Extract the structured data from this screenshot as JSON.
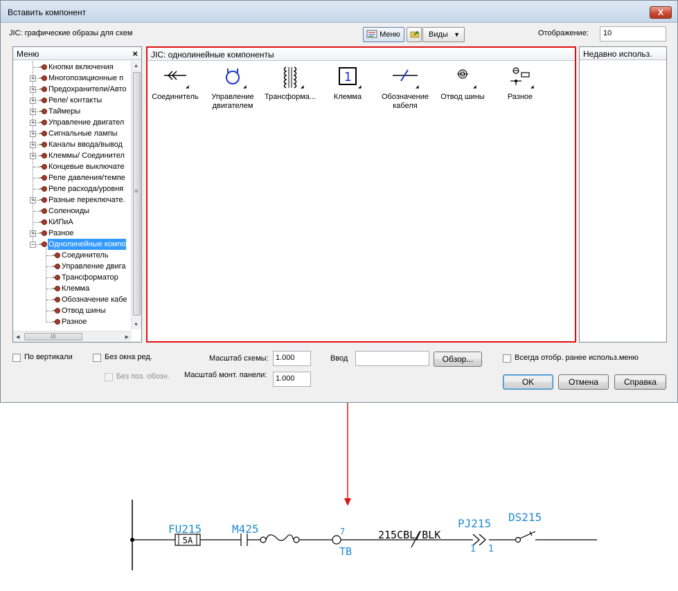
{
  "dialog": {
    "title": "Вставить компонент",
    "close_label": "X"
  },
  "toolbar": {
    "library_label": "JIC: графические образы для схем",
    "menu_button": "Меню",
    "views_button": "Виды",
    "display_label": "Отображение:",
    "display_value": "10"
  },
  "menu_panel": {
    "title": "Меню",
    "close_label": "×",
    "scroll_h_grip": "III",
    "items": [
      {
        "label": "Кнопки включения",
        "level": 0,
        "expander": "none"
      },
      {
        "label": "Многопозиционные п",
        "level": 0,
        "expander": "plus"
      },
      {
        "label": "Предохранители/Авто",
        "level": 0,
        "expander": "plus"
      },
      {
        "label": "Реле/ контакты",
        "level": 0,
        "expander": "plus"
      },
      {
        "label": "Таймеры",
        "level": 0,
        "expander": "plus"
      },
      {
        "label": "Управление двигател",
        "level": 0,
        "expander": "plus"
      },
      {
        "label": "Сигнальные лампы",
        "level": 0,
        "expander": "plus"
      },
      {
        "label": "Каналы ввода/вывод",
        "level": 0,
        "expander": "plus"
      },
      {
        "label": "Клеммы/ Соединител",
        "level": 0,
        "expander": "plus"
      },
      {
        "label": "Концевые выключате",
        "level": 0,
        "expander": "none"
      },
      {
        "label": "Реле давления/темпе",
        "level": 0,
        "expander": "none"
      },
      {
        "label": "Реле расхода/уровня",
        "level": 0,
        "expander": "none"
      },
      {
        "label": "Разные переключате.",
        "level": 0,
        "expander": "plus"
      },
      {
        "label": "Соленоиды",
        "level": 0,
        "expander": "none"
      },
      {
        "label": "КИПиА",
        "level": 0,
        "expander": "none"
      },
      {
        "label": "Разное",
        "level": 0,
        "expander": "plus"
      },
      {
        "label": "Однолинейные компо",
        "level": 0,
        "expander": "minus",
        "selected": true
      },
      {
        "label": "Соединитель",
        "level": 1,
        "expander": "none"
      },
      {
        "label": "Управление двига",
        "level": 1,
        "expander": "none"
      },
      {
        "label": "Трансформатор",
        "level": 1,
        "expander": "none"
      },
      {
        "label": "Клемма",
        "level": 1,
        "expander": "none"
      },
      {
        "label": "Обозначение кабе",
        "level": 1,
        "expander": "none"
      },
      {
        "label": "Отвод шины",
        "level": 1,
        "expander": "none"
      },
      {
        "label": "Разное",
        "level": 1,
        "expander": "none"
      }
    ]
  },
  "components_panel": {
    "title": "JIC: однолинейные компоненты",
    "items": [
      {
        "icon": "connector-icon",
        "label": "Соединитель"
      },
      {
        "icon": "motor-control-icon",
        "label": "Управление двигателем"
      },
      {
        "icon": "transformer-icon",
        "label": "Трансформа..."
      },
      {
        "icon": "terminal-icon",
        "label": "Клемма",
        "glyph": "1"
      },
      {
        "icon": "cable-marker-icon",
        "label": "Обозначение кабеля"
      },
      {
        "icon": "bus-tap-icon",
        "label": "Отвод шины"
      },
      {
        "icon": "misc-icon",
        "label": "Разное"
      }
    ]
  },
  "recent_panel": {
    "title": "Недавно использ."
  },
  "options": {
    "vertical": "По вертикали",
    "no_edit_window": "Без окна ред.",
    "no_pos_designation": "Без поз. обозн.",
    "schematic_scale_label": "Масштаб схемы:",
    "schematic_scale_value": "1.000",
    "panel_scale_label": "Масштаб монт. панели:",
    "panel_scale_value": "1.000",
    "input_label": "Ввод",
    "input_value": "",
    "browse_button": "Обзор...",
    "always_show_recent": "Всегда отобр. ранее использ.меню",
    "ok_button": "OK",
    "cancel_button": "Отмена",
    "help_button": "Справка"
  },
  "schematic": {
    "fuse_tag": "FU215",
    "fuse_rating": "5A",
    "motor_tag": "M425",
    "terminal_number": "7",
    "terminal_tag": "TB",
    "cable_label": "215CBL/BLK",
    "connector_tag": "PJ215",
    "connector_pin_left": "1",
    "connector_pin_right": "1",
    "disconnect_tag": "DS215",
    "label_color": "#1f8ad0",
    "highlight_color": "#e01010"
  }
}
